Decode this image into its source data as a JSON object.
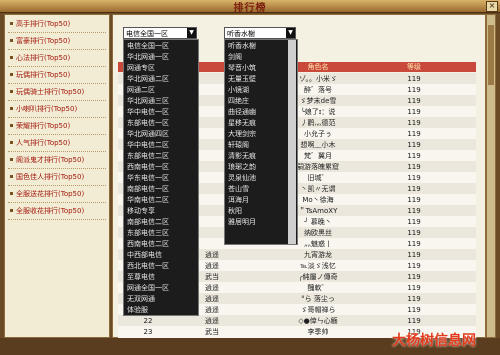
{
  "window": {
    "title": "排行榜",
    "close_label": "×"
  },
  "categories": [
    "高手排行(Top50)",
    "富豪排行(Top50)",
    "心法排行(Top50)",
    "玩偶排行(Top50)",
    "玩偶骑士排行(Top50)",
    "小喇叭排行(Top50)",
    "荣耀排行(Top50)",
    "人气排行(Top50)",
    "阁派鬼才排行(Top50)",
    "国色佳人排行(Top50)",
    "全服送花排行(Top50)",
    "全服收花排行(Top50)"
  ],
  "filters": {
    "server_selected": "电信全国一区",
    "line_selected": "听香水榭"
  },
  "server_dropdown": [
    "电信全国一区",
    "华北网通一区",
    "网通专区",
    "华北网通二区",
    "网通二区",
    "华北网通三区",
    "华中电信一区",
    "东部电信一区",
    "华北网通四区",
    "华中电信二区",
    "东部电信二区",
    "西南电信一区",
    "华东电信一区",
    "南部电信一区",
    "华南电信二区",
    "移动专享",
    "南部电信二区",
    "东部电信三区",
    "西南电信二区",
    "中西部电信",
    "西北电信一区",
    "至尊电信",
    "网通全国一区",
    "无双网通",
    "体验服"
  ],
  "line_dropdown": [
    "听香水榭",
    "剑阁",
    "琴音小筑",
    "无量玉壁",
    "小镜湖",
    "四绝庄",
    "曲径通幽",
    "星移无痕",
    "大理剑宗",
    "轩辕阁",
    "清影无痕",
    "琅琊之韵",
    "灵泉仙池",
    "苍山雪",
    "洱海月",
    "秋阳",
    "雅居明月"
  ],
  "table": {
    "headers": [
      "",
      "",
      "角色名",
      "等级"
    ],
    "rows": [
      {
        "rank": "",
        "line": "",
        "name": "ゾ。。小米ゞ",
        "level": "119"
      },
      {
        "rank": "",
        "line": "",
        "name": "醉゛落号",
        "level": "119"
      },
      {
        "rank": "",
        "line": "",
        "name": "ゞ梦末de雪",
        "level": "119"
      },
      {
        "rank": "",
        "line": "",
        "name": "╰娘了ɪ：说",
        "level": "119"
      },
      {
        "rank": "",
        "line": "",
        "name": "丿鹳灬德范",
        "level": "119"
      },
      {
        "rank": "",
        "line": "",
        "name": "小允子ぅ",
        "level": "119"
      },
      {
        "rank": "",
        "line": "",
        "name": "想啊﹏小木",
        "level": "119"
      },
      {
        "rank": "",
        "line": "",
        "name": "梵゛翼月",
        "level": "119"
      },
      {
        "rank": "",
        "line": "",
        "name": "嗣游落魄累窟",
        "level": "119"
      },
      {
        "rank": "",
        "line": "",
        "name": "旧城゛",
        "level": "119"
      },
      {
        "rank": "",
        "line": "",
        "name": "丶凯〃无谓",
        "level": "119"
      },
      {
        "rank": "",
        "line": "",
        "name": "Mo丶徐海",
        "level": "119"
      },
      {
        "rank": "",
        "line": "",
        "name": "＂TsAmoXY",
        "level": "119"
      },
      {
        "rank": "",
        "line": "",
        "name": "╯ 慕晚丶",
        "level": "119"
      },
      {
        "rank": "",
        "line": "",
        "name": "纳欧黑丝",
        "level": "119"
      },
      {
        "rank": "",
        "line": "",
        "name": "灬魅惑丨",
        "level": "119"
      },
      {
        "rank": "",
        "line": "逍遥",
        "name": "九宵游龙",
        "level": "119"
      },
      {
        "rank": "",
        "line": "逍遥",
        "name": "℡淡ゞ浅忆",
        "level": "119"
      },
      {
        "rank": "",
        "line": "武当",
        "name": "╭純屬ノ傳奇",
        "level": "119"
      },
      {
        "rank": "",
        "line": "逍遥",
        "name": "醜軟゛",
        "level": "119"
      },
      {
        "rank": "",
        "line": "逍遥",
        "name": "°ら 落尘っ",
        "level": "119"
      },
      {
        "rank": "",
        "line": "逍遥",
        "name": "ゞ哥帽禅ら",
        "level": "119"
      },
      {
        "rank": "22",
        "line": "逍遥",
        "name": "◇●倖ㄣ心觞",
        "level": "119"
      },
      {
        "rank": "23",
        "line": "武当",
        "name": "李季帅",
        "level": "119"
      }
    ]
  },
  "watermark": "大杨树信息网"
}
